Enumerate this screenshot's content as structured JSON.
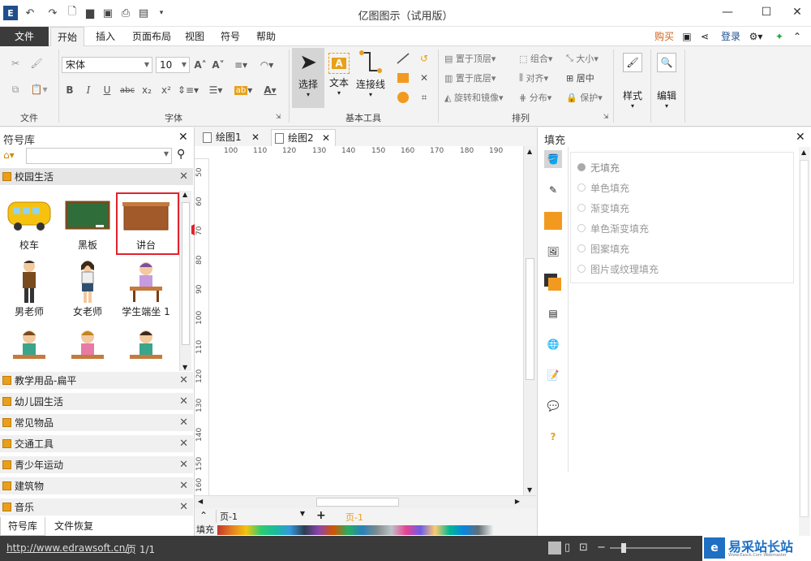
{
  "app": {
    "title": "亿图图示（试用版）"
  },
  "menu": {
    "file": "文件",
    "tabs": [
      "开始",
      "插入",
      "页面布局",
      "视图",
      "符号",
      "帮助"
    ],
    "buy": "购买",
    "login": "登录"
  },
  "ribbon": {
    "groups": {
      "file": "文件",
      "font": "字体",
      "basic_tools": "基本工具",
      "arrange": "排列"
    },
    "font_name": "宋体",
    "font_size": "10",
    "select": "选择",
    "text": "文本",
    "connector": "连接线",
    "arrange_items": [
      "置于顶层",
      "置于底层",
      "旋转和镜像",
      "组合",
      "对齐",
      "分布",
      "大小",
      "居中",
      "保护"
    ],
    "style": "样式",
    "edit": "编辑"
  },
  "library": {
    "title": "符号库",
    "search_placeholder": "",
    "current_category": "校园生活",
    "shapes": [
      "校车",
      "黑板",
      "讲台",
      "男老师",
      "女老师",
      "学生端坐 1"
    ],
    "categories": [
      "教学用品-扁平",
      "幼儿园生活",
      "常见物品",
      "交通工具",
      "青少年运动",
      "建筑物",
      "音乐"
    ],
    "bottom_tabs": [
      "符号库",
      "文件恢复"
    ]
  },
  "documents": {
    "tabs": [
      "绘图1",
      "绘图2"
    ]
  },
  "rulers": {
    "top": [
      "100",
      "110",
      "120",
      "130",
      "140",
      "150",
      "160",
      "170",
      "180",
      "190"
    ],
    "left": [
      "50",
      "60",
      "70",
      "80",
      "90",
      "100",
      "110",
      "120",
      "130",
      "140",
      "150",
      "160"
    ]
  },
  "fill_panel": {
    "title": "填充",
    "options": [
      "无填充",
      "单色填充",
      "渐变填充",
      "单色渐变填充",
      "图案填充",
      "图片或纹理填充"
    ]
  },
  "pages": {
    "selector": "页-1",
    "active_page": "页-1",
    "fill_label": "填充"
  },
  "status": {
    "url": "http://www.edrawsoft.cn/",
    "page": "页 1/1",
    "watermark": "易采站长站",
    "watermark_sub": "Www.Easck.Com Webmaster"
  },
  "colors": {
    "accent": "#e8a01b",
    "highlight": "#e0232e"
  }
}
